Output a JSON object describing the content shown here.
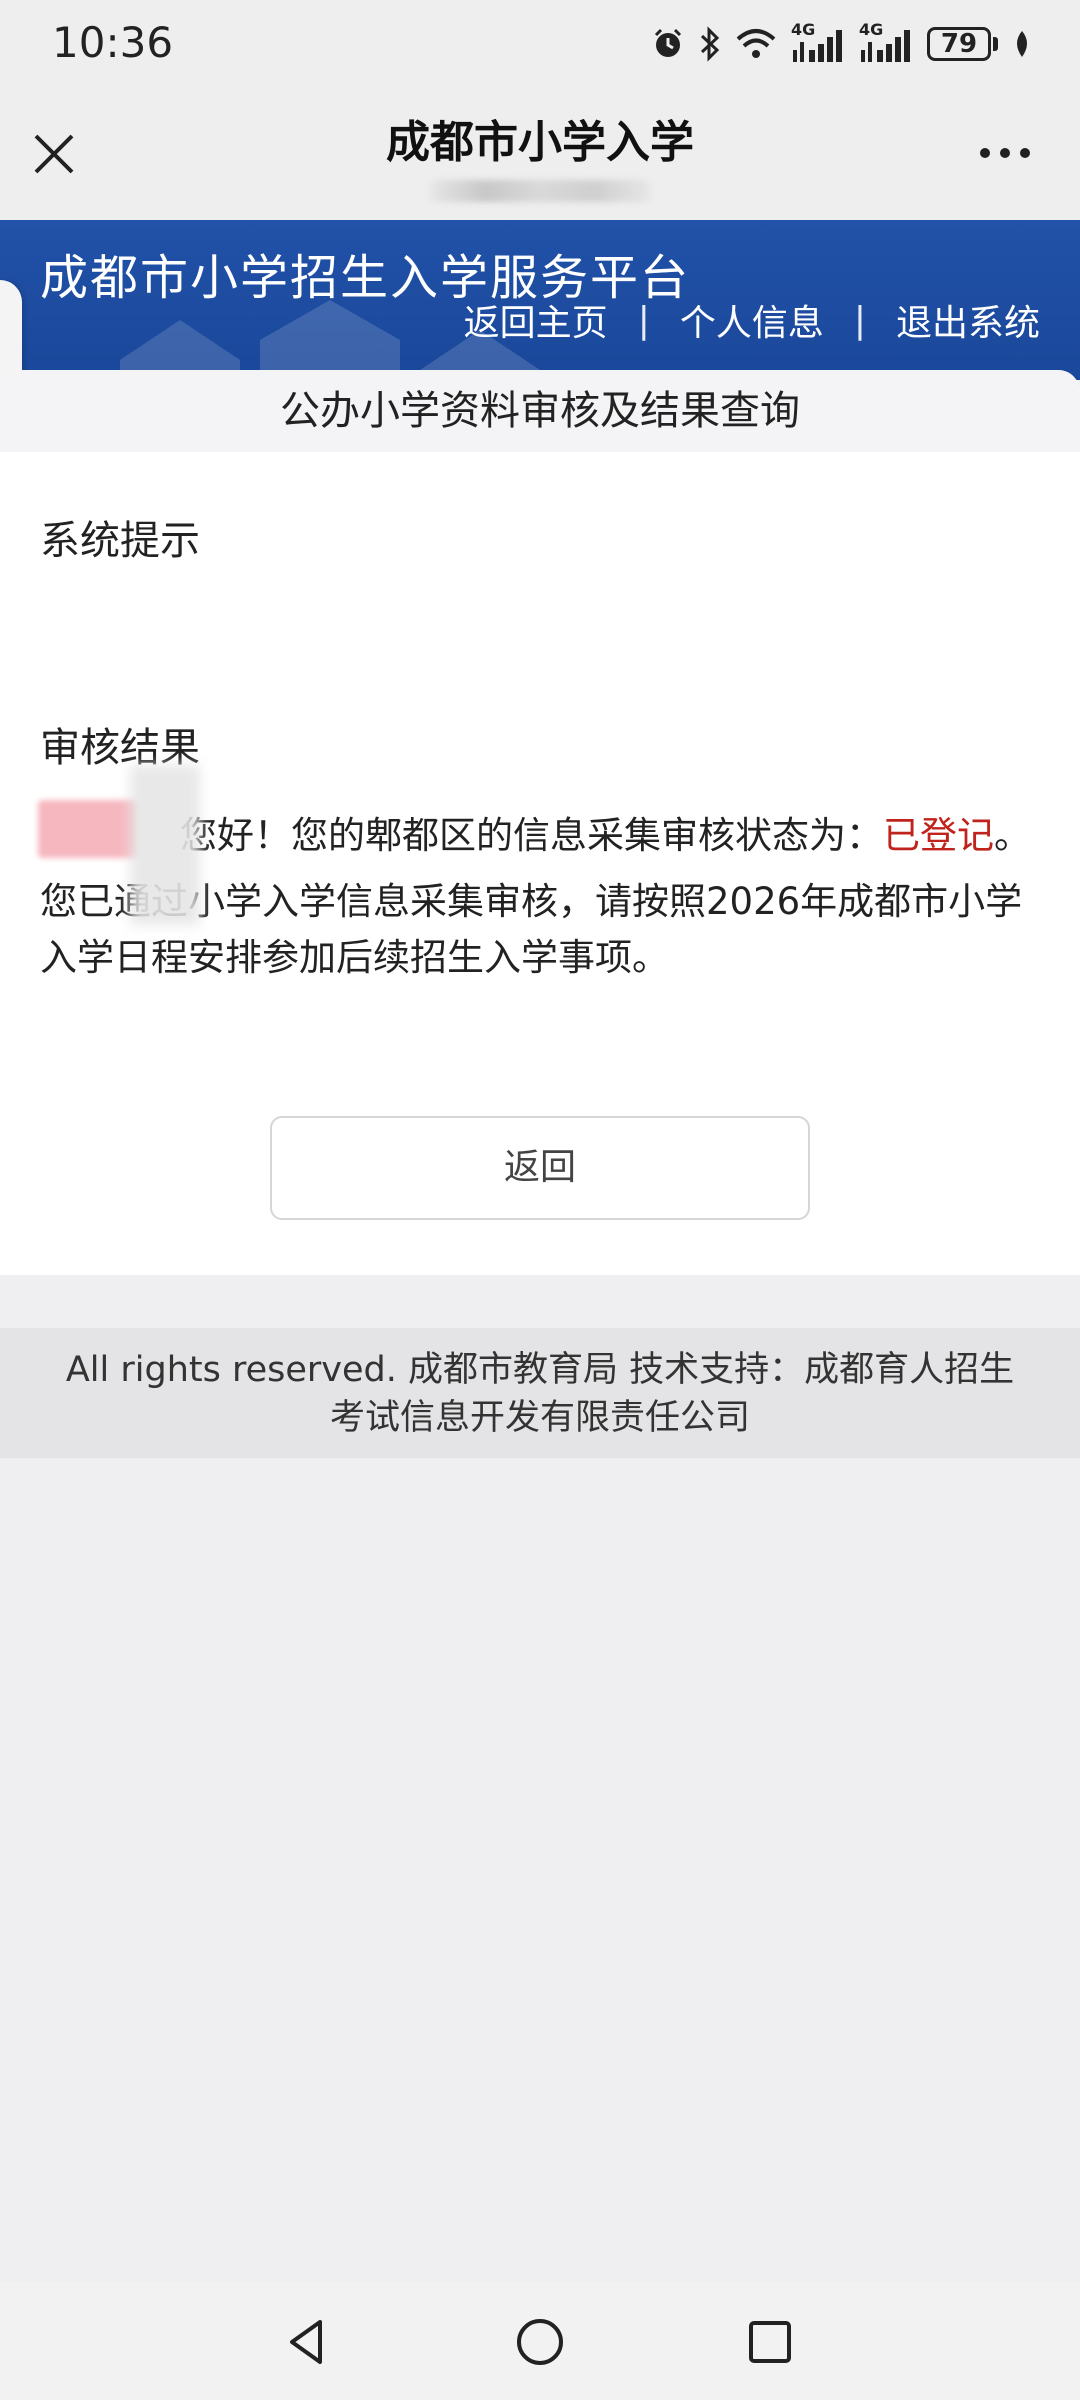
{
  "status_bar": {
    "time": "10:36",
    "network_1": "4G",
    "network_2": "4G",
    "battery": "79"
  },
  "nav_bar": {
    "title": "成都市小学入学"
  },
  "banner": {
    "title": "成都市小学招生入学服务平台",
    "links": [
      "返回主页",
      "个人信息",
      "退出系统"
    ],
    "separator": "|",
    "color": "#1c4da1"
  },
  "section": {
    "header": "公办小学资料审核及结果查询",
    "tip_label": "系统提示",
    "result_label": "审核结果",
    "greeting_prefix": "您好！您的郫都区的信息采集审核状态为：",
    "status_value": "已登记",
    "greeting_suffix": "。",
    "notice": "您已通过小学入学信息采集审核，请按照2026年成都市小学入学日程安排参加后续招生入学事项。",
    "back_button": "返回",
    "status_color": "#c0221c"
  },
  "footer": {
    "line1": "All rights reserved. 成都市教育局  技术支持：成都育人招生",
    "line2": "考试信息开发有限责任公司"
  },
  "system_nav": {
    "icons": [
      "back-triangle-icon",
      "home-circle-icon",
      "recents-square-icon"
    ]
  }
}
